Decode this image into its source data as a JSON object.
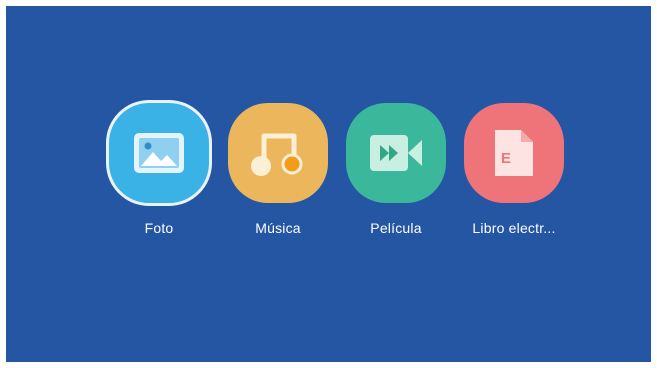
{
  "home": {
    "selected_index": 0,
    "apps": [
      {
        "label": "Foto",
        "icon": "photo-icon",
        "color": "#3bb2e6"
      },
      {
        "label": "Música",
        "icon": "music-icon",
        "color": "#ecb75c"
      },
      {
        "label": "Película",
        "icon": "video-icon",
        "color": "#3bb89b"
      },
      {
        "label": "Libro electr...",
        "icon": "ebook-icon",
        "color": "#ee7479"
      }
    ]
  },
  "colors": {
    "background": "#2456a3",
    "frame": "#ffffff",
    "selection_ring": "#eaf3fb",
    "label": "#ffffff"
  }
}
